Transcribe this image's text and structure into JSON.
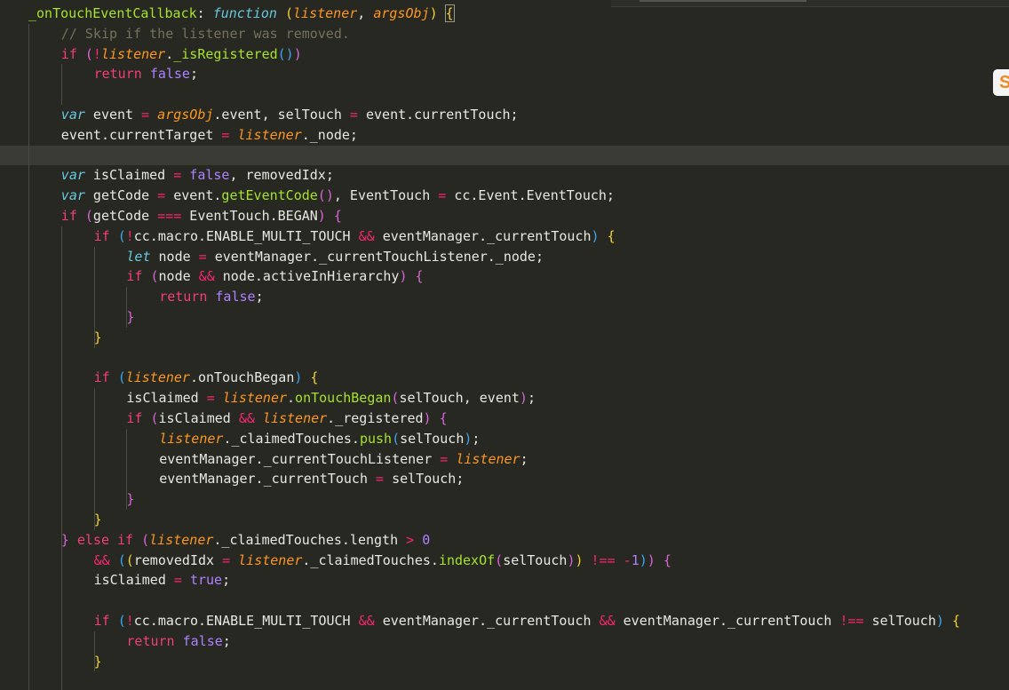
{
  "editor": {
    "colors": {
      "background": "#272822",
      "current_line": "#3a3b35",
      "default_text": "#e8e8e2",
      "keyword": "#f23e7a",
      "keyword_storage": "#69c7e0",
      "constant": "#ae81ff",
      "parameter": "#fd971f",
      "function_name": "#a6e22e",
      "operator": "#f92672",
      "comment": "#75715e",
      "bracket_level_1": "#f3d22e",
      "bracket_level_2": "#d765d7",
      "bracket_level_3": "#3ca5f0"
    },
    "current_line_index": 7,
    "lines": [
      {
        "indent": 0,
        "tokens": [
          [
            "fnname",
            "_onTouchEventCallback"
          ],
          [
            "plain",
            ": "
          ],
          [
            "kwi",
            "function"
          ],
          [
            "plain",
            " "
          ],
          [
            "p1",
            "("
          ],
          [
            "param",
            "listener"
          ],
          [
            "plain",
            ", "
          ],
          [
            "param",
            "argsObj"
          ],
          [
            "p1",
            ")"
          ],
          [
            "plain",
            " "
          ],
          [
            "cursor",
            "{"
          ]
        ]
      },
      {
        "indent": 1,
        "tokens": [
          [
            "comment",
            "// Skip if the listener was removed."
          ]
        ]
      },
      {
        "indent": 1,
        "tokens": [
          [
            "kw",
            "if"
          ],
          [
            "plain",
            " "
          ],
          [
            "p2",
            "("
          ],
          [
            "op",
            "!"
          ],
          [
            "param",
            "listener"
          ],
          [
            "plain",
            "."
          ],
          [
            "method",
            "_isRegistered"
          ],
          [
            "p3",
            "()"
          ],
          [
            "p2",
            ")"
          ]
        ]
      },
      {
        "indent": 2,
        "tokens": [
          [
            "kw",
            "return"
          ],
          [
            "plain",
            " "
          ],
          [
            "bool",
            "false"
          ],
          [
            "plain",
            ";"
          ]
        ]
      },
      {
        "indent": 0,
        "tokens": []
      },
      {
        "indent": 1,
        "tokens": [
          [
            "kwi",
            "var"
          ],
          [
            "plain",
            " event "
          ],
          [
            "op",
            "="
          ],
          [
            "plain",
            " "
          ],
          [
            "param",
            "argsObj"
          ],
          [
            "plain",
            ".event, selTouch "
          ],
          [
            "op",
            "="
          ],
          [
            "plain",
            " event.currentTouch;"
          ]
        ]
      },
      {
        "indent": 1,
        "tokens": [
          [
            "plain",
            "event.currentTarget "
          ],
          [
            "op",
            "="
          ],
          [
            "plain",
            " "
          ],
          [
            "param",
            "listener"
          ],
          [
            "plain",
            "._node;"
          ]
        ]
      },
      {
        "indent": 0,
        "tokens": []
      },
      {
        "indent": 1,
        "tokens": [
          [
            "kwi",
            "var"
          ],
          [
            "plain",
            " isClaimed "
          ],
          [
            "op",
            "="
          ],
          [
            "plain",
            " "
          ],
          [
            "bool",
            "false"
          ],
          [
            "plain",
            ", removedIdx;"
          ]
        ]
      },
      {
        "indent": 1,
        "tokens": [
          [
            "kwi",
            "var"
          ],
          [
            "plain",
            " getCode "
          ],
          [
            "op",
            "="
          ],
          [
            "plain",
            " event."
          ],
          [
            "method",
            "getEventCode"
          ],
          [
            "p2",
            "()"
          ],
          [
            "plain",
            ", EventTouch "
          ],
          [
            "op",
            "="
          ],
          [
            "plain",
            " cc.Event.EventTouch;"
          ]
        ]
      },
      {
        "indent": 1,
        "tokens": [
          [
            "kw",
            "if"
          ],
          [
            "plain",
            " "
          ],
          [
            "p2",
            "("
          ],
          [
            "plain",
            "getCode "
          ],
          [
            "op",
            "==="
          ],
          [
            "plain",
            " EventTouch.BEGAN"
          ],
          [
            "p2",
            ")"
          ],
          [
            "plain",
            " "
          ],
          [
            "p2",
            "{"
          ]
        ]
      },
      {
        "indent": 2,
        "tokens": [
          [
            "kw",
            "if"
          ],
          [
            "plain",
            " "
          ],
          [
            "p3",
            "("
          ],
          [
            "op",
            "!"
          ],
          [
            "plain",
            "cc.macro.ENABLE_MULTI_TOUCH "
          ],
          [
            "op",
            "&&"
          ],
          [
            "plain",
            " eventManager._currentTouch"
          ],
          [
            "p3",
            ")"
          ],
          [
            "plain",
            " "
          ],
          [
            "p1",
            "{"
          ]
        ]
      },
      {
        "indent": 3,
        "tokens": [
          [
            "kwi",
            "let"
          ],
          [
            "plain",
            " node "
          ],
          [
            "op",
            "="
          ],
          [
            "plain",
            " eventManager._currentTouchListener._node;"
          ]
        ]
      },
      {
        "indent": 3,
        "tokens": [
          [
            "kw",
            "if"
          ],
          [
            "plain",
            " "
          ],
          [
            "p2",
            "("
          ],
          [
            "plain",
            "node "
          ],
          [
            "op",
            "&&"
          ],
          [
            "plain",
            " node.activeInHierarchy"
          ],
          [
            "p2",
            ")"
          ],
          [
            "plain",
            " "
          ],
          [
            "p2",
            "{"
          ]
        ]
      },
      {
        "indent": 4,
        "tokens": [
          [
            "kw",
            "return"
          ],
          [
            "plain",
            " "
          ],
          [
            "bool",
            "false"
          ],
          [
            "plain",
            ";"
          ]
        ]
      },
      {
        "indent": 3,
        "tokens": [
          [
            "p2",
            "}"
          ]
        ]
      },
      {
        "indent": 2,
        "tokens": [
          [
            "p1",
            "}"
          ]
        ]
      },
      {
        "indent": 0,
        "tokens": []
      },
      {
        "indent": 2,
        "tokens": [
          [
            "kw",
            "if"
          ],
          [
            "plain",
            " "
          ],
          [
            "p3",
            "("
          ],
          [
            "param",
            "listener"
          ],
          [
            "plain",
            ".onTouchBegan"
          ],
          [
            "p3",
            ")"
          ],
          [
            "plain",
            " "
          ],
          [
            "p1",
            "{"
          ]
        ]
      },
      {
        "indent": 3,
        "tokens": [
          [
            "plain",
            "isClaimed "
          ],
          [
            "op",
            "="
          ],
          [
            "plain",
            " "
          ],
          [
            "param",
            "listener"
          ],
          [
            "plain",
            "."
          ],
          [
            "method",
            "onTouchBegan"
          ],
          [
            "p2",
            "("
          ],
          [
            "plain",
            "selTouch, event"
          ],
          [
            "p2",
            ")"
          ],
          [
            "plain",
            ";"
          ]
        ]
      },
      {
        "indent": 3,
        "tokens": [
          [
            "kw",
            "if"
          ],
          [
            "plain",
            " "
          ],
          [
            "p2",
            "("
          ],
          [
            "plain",
            "isClaimed "
          ],
          [
            "op",
            "&&"
          ],
          [
            "plain",
            " "
          ],
          [
            "param",
            "listener"
          ],
          [
            "plain",
            "._registered"
          ],
          [
            "p2",
            ")"
          ],
          [
            "plain",
            " "
          ],
          [
            "p2",
            "{"
          ]
        ]
      },
      {
        "indent": 4,
        "tokens": [
          [
            "param",
            "listener"
          ],
          [
            "plain",
            "._claimedTouches."
          ],
          [
            "method",
            "push"
          ],
          [
            "p3",
            "("
          ],
          [
            "plain",
            "selTouch"
          ],
          [
            "p3",
            ")"
          ],
          [
            "plain",
            ";"
          ]
        ]
      },
      {
        "indent": 4,
        "tokens": [
          [
            "plain",
            "eventManager._currentTouchListener "
          ],
          [
            "op",
            "="
          ],
          [
            "plain",
            " "
          ],
          [
            "param",
            "listener"
          ],
          [
            "plain",
            ";"
          ]
        ]
      },
      {
        "indent": 4,
        "tokens": [
          [
            "plain",
            "eventManager._currentTouch "
          ],
          [
            "op",
            "="
          ],
          [
            "plain",
            " selTouch;"
          ]
        ]
      },
      {
        "indent": 3,
        "tokens": [
          [
            "p2",
            "}"
          ]
        ]
      },
      {
        "indent": 2,
        "tokens": [
          [
            "p1",
            "}"
          ]
        ]
      },
      {
        "indent": 1,
        "tokens": [
          [
            "p2",
            "}"
          ],
          [
            "plain",
            " "
          ],
          [
            "kw",
            "else"
          ],
          [
            "plain",
            " "
          ],
          [
            "kw",
            "if"
          ],
          [
            "plain",
            " "
          ],
          [
            "p2",
            "("
          ],
          [
            "param",
            "listener"
          ],
          [
            "plain",
            "._claimedTouches.length "
          ],
          [
            "op",
            ">"
          ],
          [
            "plain",
            " "
          ],
          [
            "num",
            "0"
          ]
        ]
      },
      {
        "indent": 2,
        "tokens": [
          [
            "op",
            "&&"
          ],
          [
            "plain",
            " "
          ],
          [
            "p3",
            "("
          ],
          [
            "p1",
            "("
          ],
          [
            "plain",
            "removedIdx "
          ],
          [
            "op",
            "="
          ],
          [
            "plain",
            " "
          ],
          [
            "param",
            "listener"
          ],
          [
            "plain",
            "._claimedTouches."
          ],
          [
            "method",
            "indexOf"
          ],
          [
            "p2",
            "("
          ],
          [
            "plain",
            "selTouch"
          ],
          [
            "p2",
            ")"
          ],
          [
            "p1",
            ")"
          ],
          [
            "plain",
            " "
          ],
          [
            "op",
            "!=="
          ],
          [
            "plain",
            " "
          ],
          [
            "op",
            "-"
          ],
          [
            "num",
            "1"
          ],
          [
            "p3",
            ")"
          ],
          [
            "p2",
            ")"
          ],
          [
            "plain",
            " "
          ],
          [
            "p2",
            "{"
          ]
        ]
      },
      {
        "indent": 2,
        "tokens": [
          [
            "plain",
            "isClaimed "
          ],
          [
            "op",
            "="
          ],
          [
            "plain",
            " "
          ],
          [
            "bool",
            "true"
          ],
          [
            "plain",
            ";"
          ]
        ]
      },
      {
        "indent": 0,
        "tokens": []
      },
      {
        "indent": 2,
        "tokens": [
          [
            "kw",
            "if"
          ],
          [
            "plain",
            " "
          ],
          [
            "p3",
            "("
          ],
          [
            "op",
            "!"
          ],
          [
            "plain",
            "cc.macro.ENABLE_MULTI_TOUCH "
          ],
          [
            "op",
            "&&"
          ],
          [
            "plain",
            " eventManager._currentTouch "
          ],
          [
            "op",
            "&&"
          ],
          [
            "plain",
            " eventManager._currentTouch "
          ],
          [
            "op",
            "!=="
          ],
          [
            "plain",
            " selTouch"
          ],
          [
            "p3",
            ")"
          ],
          [
            "plain",
            " "
          ],
          [
            "p1",
            "{"
          ]
        ]
      },
      {
        "indent": 3,
        "tokens": [
          [
            "kw",
            "return"
          ],
          [
            "plain",
            " "
          ],
          [
            "bool",
            "false"
          ],
          [
            "plain",
            ";"
          ]
        ]
      },
      {
        "indent": 2,
        "tokens": [
          [
            "p1",
            "}"
          ]
        ]
      }
    ],
    "guides": [
      {
        "level": 0,
        "from": 1,
        "to": 34
      },
      {
        "level": 1,
        "from": 3,
        "to": 4
      },
      {
        "level": 1,
        "from": 11,
        "to": 26
      },
      {
        "level": 1,
        "from": 27,
        "to": 34
      },
      {
        "level": 2,
        "from": 12,
        "to": 16
      },
      {
        "level": 2,
        "from": 19,
        "to": 25
      },
      {
        "level": 2,
        "from": 31,
        "to": 32
      },
      {
        "level": 3,
        "from": 14,
        "to": 15
      },
      {
        "level": 3,
        "from": 21,
        "to": 24
      }
    ]
  },
  "side_badge": {
    "glyph": "S",
    "color": "#f08a1e"
  }
}
